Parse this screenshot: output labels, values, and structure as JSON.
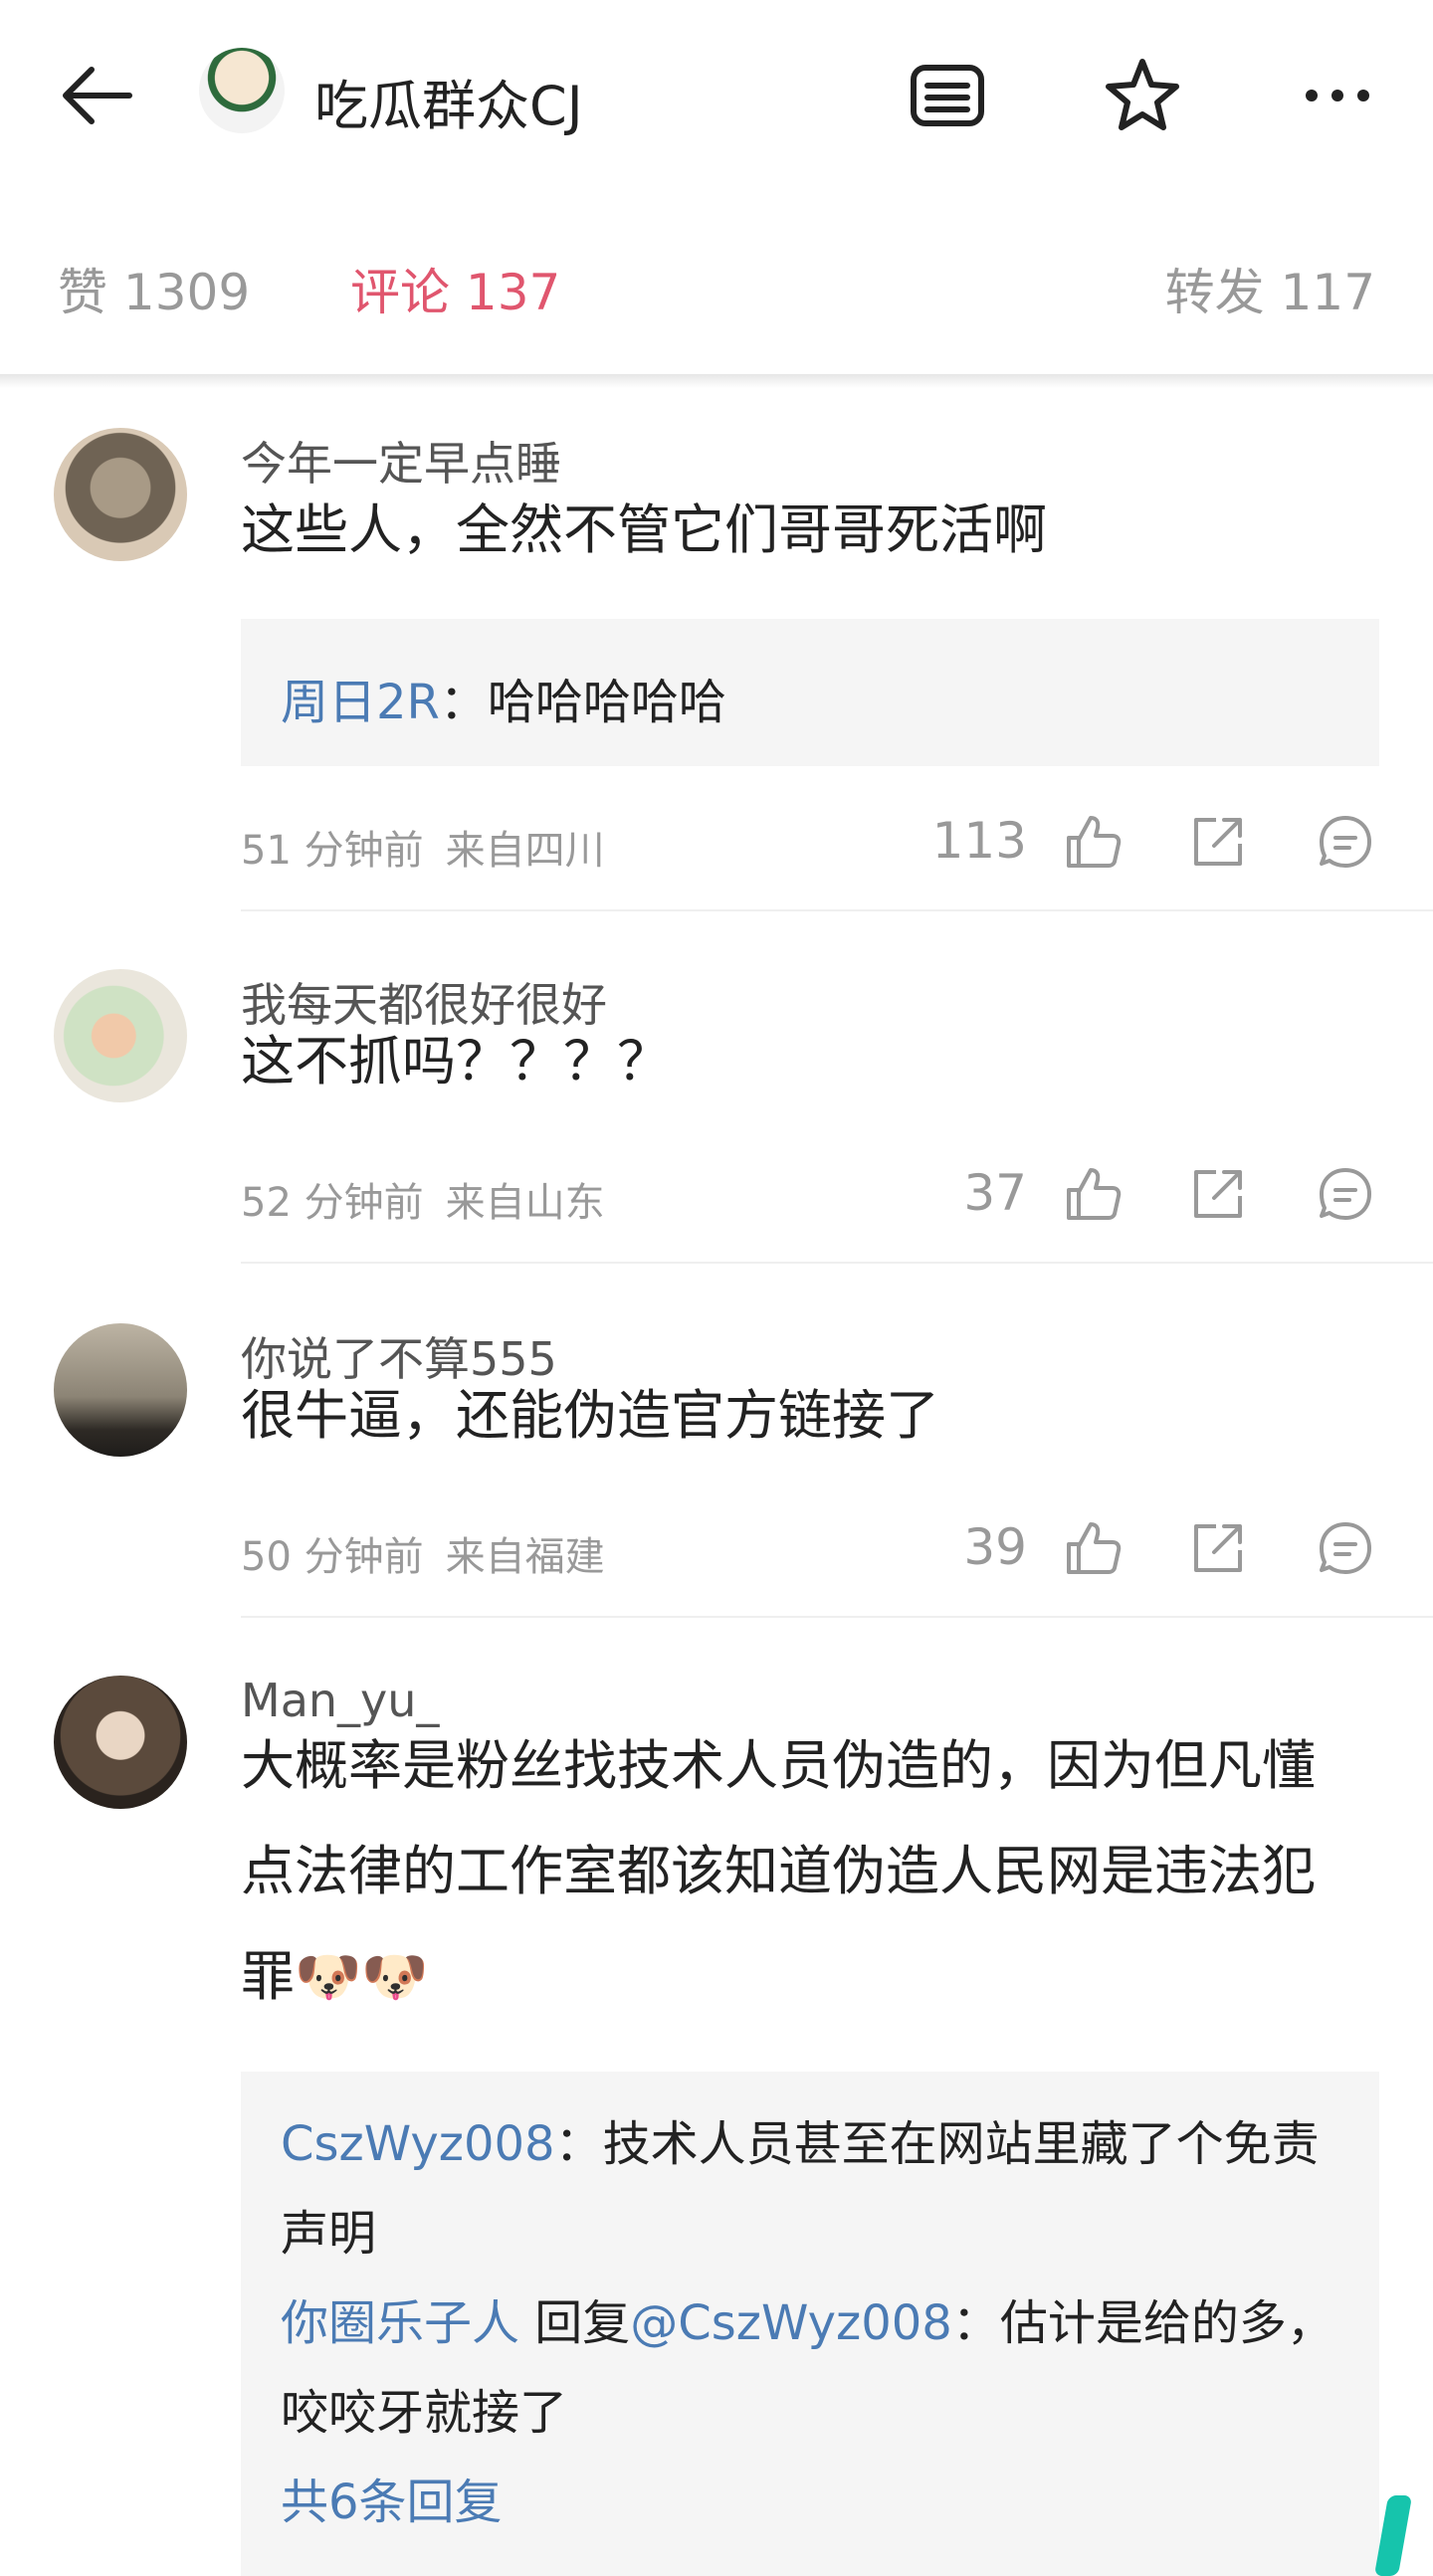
{
  "header": {
    "title": "吃瓜群众CJ"
  },
  "tabs": {
    "like": "赞 1309",
    "comment": "评论 137",
    "repost": "转发 117"
  },
  "comments": [
    {
      "name": "今年一定早点睡",
      "text": "这些人，全然不管它们哥哥死活啊",
      "reply": {
        "user": "周日2R",
        "sep": "：",
        "text": "哈哈哈哈哈"
      },
      "time": "51 分钟前",
      "location": "来自四川",
      "likes": "113"
    },
    {
      "name": "我每天都很好很好",
      "text": "这不抓吗？？？？",
      "time": "52 分钟前",
      "location": "来自山东",
      "likes": "37"
    },
    {
      "name": "你说了不算555",
      "text": "很牛逼，还能伪造官方链接了",
      "time": "50 分钟前",
      "location": "来自福建",
      "likes": "39"
    },
    {
      "name": "Man_yu_",
      "text_line1": "大概率是粉丝找技术人员伪造的，因为但凡懂",
      "text_line2": "点法律的工作室都该知道伪造人民网是违法犯",
      "text_line3": "罪",
      "emoji": "🐶🐶",
      "replies": [
        {
          "user": "CszWyz008",
          "sep": "：",
          "text": "技术人员甚至在网站里藏了个免责",
          "text2": "声明"
        },
        {
          "user": "你圈乐子人",
          "mid": " 回复",
          "target": "@CszWyz008",
          "sep": "：",
          "text": "估计是给的多，",
          "text2": "咬咬牙就接了"
        }
      ],
      "more_replies": "共6条回复"
    }
  ],
  "colors": {
    "accent": "#e0566e",
    "link": "#4b7bb4",
    "muted": "#999999"
  }
}
